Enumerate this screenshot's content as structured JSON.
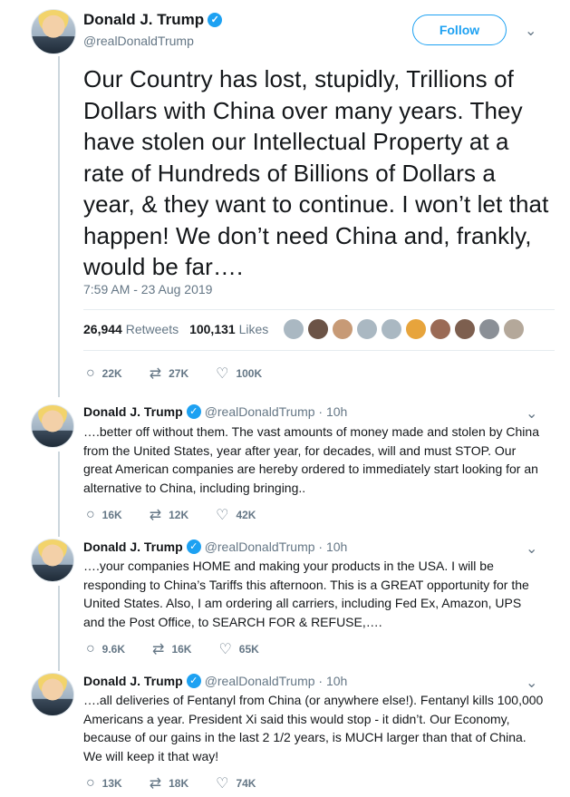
{
  "main_tweet": {
    "name": "Donald J. Trump",
    "handle": "@realDonaldTrump",
    "follow_label": "Follow",
    "text": "Our Country has lost, stupidly, Trillions of Dollars with China over many years. They have stolen our Intellectual Property at a rate of Hundreds of Billions of Dollars a year, & they want to continue. I won’t let that happen! We don’t need China and, frankly, would be far….",
    "timestamp": "7:59 AM - 23 Aug 2019",
    "retweets_count": "26,944",
    "retweets_label": "Retweets",
    "likes_count": "100,131",
    "likes_label": "Likes",
    "replies": "22K",
    "retweets": "27K",
    "likes": "100K"
  },
  "replies": [
    {
      "name": "Donald J. Trump",
      "handle": "@realDonaldTrump · 10h",
      "text": "….better off without them. The vast amounts of money made and stolen by China from the United States, year after year, for decades, will and must STOP. Our great American companies are hereby ordered to immediately start looking for an alternative to China, including bringing..",
      "replies": "16K",
      "retweets": "12K",
      "likes": "42K"
    },
    {
      "name": "Donald J. Trump",
      "handle": "@realDonaldTrump · 10h",
      "text": "….your companies HOME and making your products in the USA. I will be responding to China’s Tariffs this afternoon. This is a GREAT opportunity for the United States. Also, I am ordering all carriers, including Fed Ex, Amazon, UPS and the Post Office, to SEARCH FOR & REFUSE,….",
      "replies": "9.6K",
      "retweets": "16K",
      "likes": "65K"
    },
    {
      "name": "Donald J. Trump",
      "handle": "@realDonaldTrump · 10h",
      "text": "….all deliveries of Fentanyl from China (or anywhere else!). Fentanyl kills 100,000 Americans a year. President Xi said this would stop - it didn’t. Our Economy, because of our gains in the last 2 1/2 years, is MUCH larger than that of China. We will keep it that way!",
      "replies": "13K",
      "retweets": "18K",
      "likes": "74K"
    }
  ],
  "icons": {
    "reply": "reply-icon",
    "retweet": "retweet-icon",
    "like": "heart-icon",
    "verified": "verified-badge-icon",
    "caret": "chevron-down-icon"
  },
  "colors": {
    "accent": "#1da1f2",
    "muted": "#657786",
    "text": "#14171a",
    "thread_line": "#ccd6dd"
  }
}
